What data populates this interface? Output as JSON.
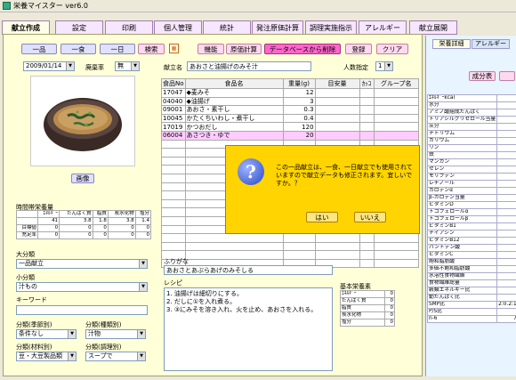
{
  "window": {
    "title": "栄養マイスター ver6.0"
  },
  "tabs": [
    "献立作成",
    "設定",
    "印刷",
    "個人管理",
    "統計",
    "発注原価計算",
    "調理実施指示",
    "アレルギー",
    "献立展開"
  ],
  "toolbar": {
    "ippin": "一品",
    "isshoku": "一食",
    "ichinichi": "一日",
    "search": "検索",
    "kinou": "機能",
    "genka": "原価計算",
    "delete_from_db": "データベースから削除",
    "register": "登録",
    "clear": "クリア"
  },
  "date": "2009/01/14",
  "haiki_label": "廃棄率",
  "haiki_value": "無",
  "menu_name_label": "献立名",
  "menu_name": "あおさと油揚げのみそ汁",
  "people_label": "人数指定",
  "people_value": "1",
  "image_button": "画像",
  "foods": {
    "headers": [
      "食品No",
      "食品名",
      "重量(g)",
      "目安量",
      "ｶｯｺ",
      "グループ名"
    ],
    "rows": [
      [
        "17047",
        "◆麦みそ",
        "12",
        "",
        "",
        ""
      ],
      [
        "04040",
        "◆油揚げ",
        "3",
        "",
        "",
        ""
      ],
      [
        "09001",
        "あおさ・素干し",
        "0.3",
        "",
        "",
        ""
      ],
      [
        "10045",
        "かたくちいわし・煮干し",
        "0.4",
        "",
        "",
        ""
      ],
      [
        "17019",
        "かつおだし",
        "120",
        "",
        "",
        ""
      ],
      [
        "06004",
        "あさつき・ゆで",
        "20",
        "",
        "",
        ""
      ]
    ]
  },
  "dialog": {
    "message": "この一品献立は、一食、一日献立でも使用されていますので献立データも修正されます。宜しいですか。？",
    "yes": "はい",
    "no": "いいえ"
  },
  "required": {
    "title": "時間帯栄養量",
    "headers": [
      "ｴﾈﾙｷﾞｰ",
      "たんぱく質",
      "脂質",
      "炭水化物",
      "塩分"
    ],
    "rows": [
      [
        "",
        "41",
        "3.8",
        "1.8",
        "3.8",
        "1.4"
      ],
      [
        "目標値",
        "0",
        "0",
        "0",
        "0",
        "0"
      ],
      [
        "充足率",
        "0",
        "0",
        "0",
        "0",
        "0"
      ]
    ]
  },
  "category": {
    "dai_label": "大分類",
    "dai_value": "一品献立",
    "sho_label": "小分類",
    "sho_value": "汁もの",
    "keyword_label": "キーワード",
    "season_label": "分類(季節別)",
    "season_value": "条件なし",
    "kind_label": "分類(種類別)",
    "kind_value": "汁物",
    "material_label": "分類(材料別)",
    "material_value": "豆・大豆製品類",
    "method_label": "分類(調理別)",
    "method_value": "スープで"
  },
  "furigana_label": "ふりがな",
  "furigana": "あおさとあぶらあげのみそしる",
  "recipe_label": "レシピ",
  "recipe": [
    "1. 油揚げは細切りにする。",
    "2. だしに①を入れ煮る。",
    "3. ③にみそを溶き入れ、火を止め、あおさを入れる。"
  ],
  "basic": {
    "title": "基本栄養素",
    "rows": [
      [
        "ｴﾈﾙｷﾞｰ",
        "0"
      ],
      [
        "たんぱく質",
        "0"
      ],
      [
        "脂質",
        "0"
      ],
      [
        "炭水化物",
        "0"
      ],
      [
        "塩分",
        "0"
      ]
    ]
  },
  "right": {
    "tabs": [
      "栄養詳細",
      "アレルギー"
    ],
    "seibunhyo": "成分表",
    "nutrients": [
      [
        "ｴﾈﾙｷﾞｰkcal",
        "41"
      ],
      [
        "水分",
        "126.0"
      ],
      [
        "アミノ酸組成たんぱく",
        "1.4"
      ],
      [
        "トリアシルグリセロール当量",
        "1.5"
      ],
      [
        "灰分",
        "1.8"
      ],
      [
        "ナトリウム",
        "547"
      ],
      [
        "カリウム",
        "31"
      ],
      [
        "リン",
        "47"
      ],
      [
        "鉄",
        "0.2"
      ],
      [
        "マンガン",
        "0.09"
      ],
      [
        "セレン",
        "0"
      ],
      [
        "モリブデン",
        "2"
      ],
      [
        "レチノール",
        "0"
      ],
      [
        "カロテンα",
        "0"
      ],
      [
        "β-カロテン当量",
        "8"
      ],
      [
        "ビタミンD",
        "0.1"
      ],
      [
        "トコフェロールα",
        "0.1"
      ],
      [
        "トコフェロールβ",
        "0.1"
      ],
      [
        "ビタミンB1",
        "0.01"
      ],
      [
        "ナイアシン",
        "0.2"
      ],
      [
        "ビタミンB12",
        "0.7"
      ],
      [
        "パントテン酸",
        "0.1"
      ],
      [
        "ビタミンC",
        "0"
      ],
      [
        "飽和脂肪酸",
        "0.28"
      ],
      [
        "多価不飽和脂肪酸",
        "0.2"
      ],
      [
        "水溶性食物繊維",
        "0.1"
      ],
      [
        "食物繊維総量",
        "0.4"
      ],
      [
        "穀類エネルギー比",
        "0"
      ],
      [
        "動たんぱく比",
        "10.7"
      ],
      [
        "SMP比",
        "2:0.2:1.5:0.9"
      ],
      [
        "P/S比",
        "2.03"
      ],
      [
        "n-6",
        "702.00"
      ]
    ]
  }
}
